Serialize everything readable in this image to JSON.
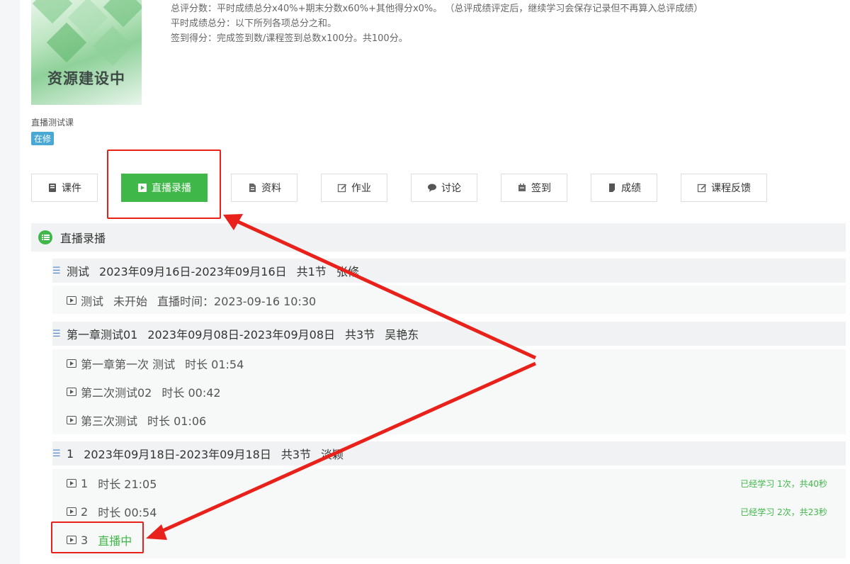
{
  "cover": {
    "title": "资源建设中"
  },
  "rules": [
    "总评分数：平时成绩总分x40%+期末分数x60%+其他得分x0%。  （总评成绩评定后，继续学习会保存记录但不再算入总评成绩）",
    "平时成绩总分：以下所列各项总分之和。",
    "签到得分：完成签到数/课程签到总数x100分。共100分。"
  ],
  "course": {
    "name": "直播测试课",
    "status": "在修"
  },
  "tabs": [
    "课件",
    "直播录播",
    "资料",
    "作业",
    "讨论",
    "签到",
    "成绩",
    "课程反馈"
  ],
  "section_title": "直播录播",
  "groups": [
    {
      "title": "测试",
      "dates": "2023年09月16日-2023年09月16日",
      "count": "共1节",
      "teacher": "张修",
      "lessons": [
        {
          "name": "测试",
          "info": "未开始",
          "extra": "直播时间：2023-09-16 10:30"
        }
      ]
    },
    {
      "title": "第一章测试01",
      "dates": "2023年09月08日-2023年09月08日",
      "count": "共3节",
      "teacher": "吴艳东",
      "lessons": [
        {
          "name": "第一章第一次 测试",
          "info": "时长 01:54"
        },
        {
          "name": "第二次测试02",
          "info": "时长 00:42"
        },
        {
          "name": "第三次测试",
          "info": "时长 01:06"
        }
      ]
    },
    {
      "title": "1",
      "dates": "2023年09月18日-2023年09月18日",
      "count": "共3节",
      "teacher": "淡颖",
      "lessons": [
        {
          "name": "1",
          "info": "时长 21:05",
          "progress": "已经学习 1次，共40秒"
        },
        {
          "name": "2",
          "info": "时长 00:54",
          "progress": "已经学习 2次，共23秒"
        },
        {
          "name": "3",
          "info": "直播中"
        }
      ]
    }
  ],
  "colors": {
    "accent": "#3fb849",
    "annotation": "#e8211b",
    "badge": "#4aa9d4"
  }
}
